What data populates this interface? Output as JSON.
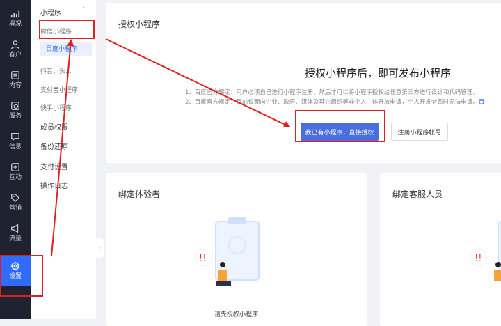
{
  "rail": {
    "items": [
      {
        "label": "概况",
        "icon": "chart-icon"
      },
      {
        "label": "客户",
        "icon": "user-icon"
      },
      {
        "label": "内容",
        "icon": "content-icon"
      },
      {
        "label": "服务",
        "icon": "service-icon"
      },
      {
        "label": "信息",
        "icon": "message-icon"
      },
      {
        "label": "互动",
        "icon": "interaction-icon"
      },
      {
        "label": "营销",
        "icon": "tag-icon"
      },
      {
        "label": "流量",
        "icon": "megaphone-icon"
      },
      {
        "label": "设置",
        "icon": "gear-icon"
      }
    ]
  },
  "subnav": {
    "group_label": "小程序",
    "items": [
      "微信小程序",
      "百度小程序",
      "抖音、头...",
      "支付宝小程序",
      "快手小程序"
    ],
    "top_items": [
      "成员权限",
      "备份还原",
      "支付设置",
      "操作日志"
    ]
  },
  "authorize_card": {
    "title": "授权小程序",
    "heading": "授权小程序后，即可发布小程序",
    "rule_1": "1、百度官方规定：用户必须自己进行小程序注册，然后才可以将小程序授权给任意第三方进行设计和代码管理。",
    "rule_2": "2、百度官方规定：目前仅面向企业、政府、媒体及其它组织等非个人主体开放申请，个人开发者暂时无法申请。",
    "rule_2_link": "百",
    "primary_button": "我已有小程序，直接授权",
    "secondary_button": "注册小程序帐号"
  },
  "tester_card": {
    "title": "绑定体验者",
    "empty_text": "请先授权小程序"
  },
  "service_card": {
    "title": "绑定客服人员"
  },
  "colors": {
    "rail_bg": "#1f2230",
    "accent": "#2f6bff",
    "primary_button": "#4a6ee0",
    "annotation": "#e02020"
  }
}
